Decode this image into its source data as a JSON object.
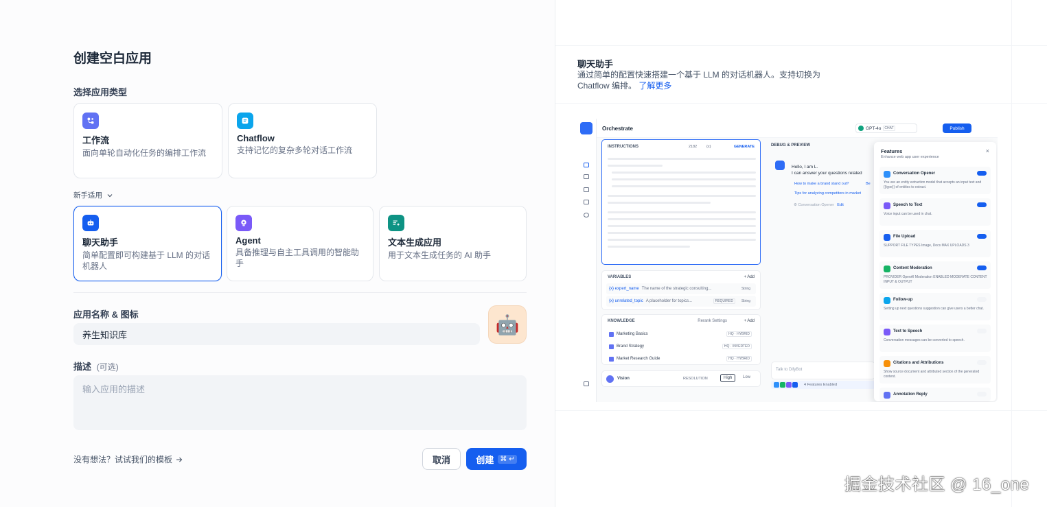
{
  "left": {
    "title": "创建空白应用",
    "type_label": "选择应用类型",
    "workflow_cards": [
      {
        "title": "工作流",
        "desc": "面向单轮自动化任务的编排工作流"
      },
      {
        "title": "Chatflow",
        "desc": "支持记忆的复杂多轮对话工作流"
      }
    ],
    "beginner_label": "新手适用",
    "beginner_cards": [
      {
        "title": "聊天助手",
        "desc": "简单配置即可构建基于 LLM 的对话机器人"
      },
      {
        "title": "Agent",
        "desc": "具备推理与自主工具调用的智能助手"
      },
      {
        "title": "文本生成应用",
        "desc": "用于文本生成任务的 AI 助手"
      }
    ],
    "name_label": "应用名称 & 图标",
    "name_value": "养生知识库",
    "avatar_emoji": "🤖",
    "desc_label": "描述",
    "desc_optional": "(可选)",
    "desc_placeholder": "输入应用的描述",
    "hint_text": "没有想法？试试我们的模板",
    "cancel_label": "取消",
    "create_label": "创建",
    "create_kbd": "⌘ ↵",
    "colors": {
      "primary": "#155eef",
      "workflow": "#6172f3",
      "chatflow": "#0ba5ec",
      "chat": "#155eef",
      "agent": "#7a5af8",
      "text": "#0e9384"
    }
  },
  "right": {
    "title": "聊天助手",
    "desc": "通过简单的配置快速搭建一个基于 LLM 的对话机器人。支持切换为 Chatflow 编排。",
    "learn_more": "了解更多",
    "mock": {
      "orchestrate": "Orchestrate",
      "model": "GPT-4o",
      "chat_tag": "CHAT",
      "publish": "Publish",
      "instructions": "INSTRUCTIONS",
      "count": "2182",
      "var_token": "{x}",
      "generate": "GENERATE",
      "variables": "VARIABLES",
      "add": "+ Add",
      "vars": [
        {
          "name": "{x} expert_name",
          "desc": "The name of the strategic consulting...",
          "type": "String"
        },
        {
          "name": "{x} unrelated_topic",
          "desc": "A placeholder for topics...",
          "type": "String",
          "req": "REQUIRED"
        }
      ],
      "knowledge": "KNOWLEDGE",
      "rerank": "Rerank Settings",
      "docs": [
        {
          "name": "Marketing Basics",
          "tag": "HQ · HYBRID"
        },
        {
          "name": "Brand Strategy",
          "tag": "HQ · INVERTED"
        },
        {
          "name": "Market Research Guide",
          "tag": "HQ · HYBRID"
        }
      ],
      "vision": "Vision",
      "resolution": "RESOLUTION",
      "high": "High",
      "low": "Low",
      "debug": "DEBUG & PREVIEW",
      "chat_line1": "Hello, I am L.",
      "chat_line2": "I can answer your questions related",
      "q1": "How to make a brand stand out?",
      "q1_cut": "Be",
      "q2": "Tips for analyzing competitors in market",
      "opener": "⚙ Conversation Opener",
      "opener_edit": "Edit",
      "talk": "Talk to DifyBot",
      "features_enabled": "4 Features Enabled",
      "features_title": "Features",
      "features_sub": "Enhance web app user experience",
      "close_icon": "×",
      "features": [
        {
          "name": "Conversation Opener",
          "desc": "You are an entity extraction model that accepts an input text and {{type}} of entities to extract.",
          "color": "#2e90fa",
          "on": true
        },
        {
          "name": "Speech to Text",
          "desc": "Voice input can be used in chat.",
          "color": "#7a5af8",
          "on": true
        },
        {
          "name": "File Upload",
          "desc": "SUPPORT FILE TYPES  Image, Docs    MAX UPLOADS 3",
          "color": "#155eef",
          "on": true
        },
        {
          "name": "Content Moderation",
          "desc": "PROVIDER OpenAI Moderation    ENABLED MODERATE CONTENT INPUT & OUTPUT",
          "color": "#16b364",
          "on": true
        },
        {
          "name": "Follow-up",
          "desc": "Setting up next questions suggestion can give users a better chat.",
          "color": "#0ba5ec",
          "on": false
        },
        {
          "name": "Text to Speech",
          "desc": "Conversation messages can be converted to speech.",
          "color": "#7a5af8",
          "on": false
        },
        {
          "name": "Citations and Attributions",
          "desc": "Show source document and attributed section of the generated content.",
          "color": "#f79009",
          "on": false
        },
        {
          "name": "Annotation Reply",
          "desc": "",
          "color": "#6172f3",
          "on": false
        }
      ]
    }
  },
  "watermark": "掘金技术社区 @ 16_one"
}
